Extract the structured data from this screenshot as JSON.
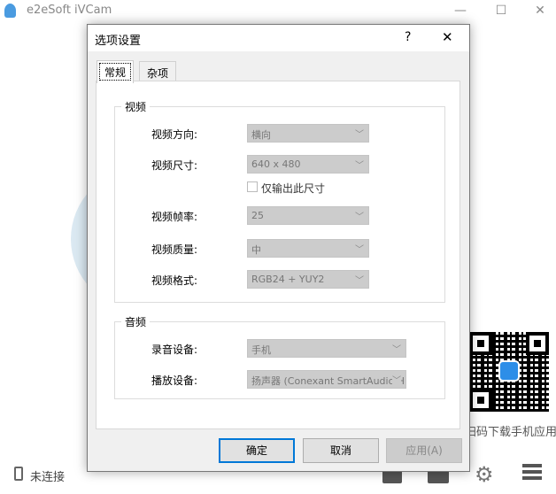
{
  "app": {
    "title": "e2eSoft iVCam",
    "qr_caption": "扫码下载手机应用",
    "status": "未连接"
  },
  "dialog": {
    "title": "选项设置",
    "help": "?",
    "close": "✕",
    "tabs": [
      {
        "label": "常规"
      },
      {
        "label": "杂项"
      }
    ],
    "video": {
      "group": "视频",
      "orientation": {
        "label": "视频方向:",
        "value": "横向"
      },
      "size": {
        "label": "视频尺寸:",
        "value": "640 x 480"
      },
      "only_size": {
        "label": "仅输出此尺寸",
        "checked": false
      },
      "fps": {
        "label": "视频帧率:",
        "value": "25"
      },
      "quality": {
        "label": "视频质量:",
        "value": "中"
      },
      "format": {
        "label": "视频格式:",
        "value": "RGB24 + YUY2"
      }
    },
    "audio": {
      "group": "音频",
      "record": {
        "label": "录音设备:",
        "value": "手机"
      },
      "playback": {
        "label": "播放设备:",
        "value": "扬声器 (Conexant SmartAudio HD)"
      }
    },
    "buttons": {
      "ok": "确定",
      "cancel": "取消",
      "apply": "应用(A)"
    }
  }
}
